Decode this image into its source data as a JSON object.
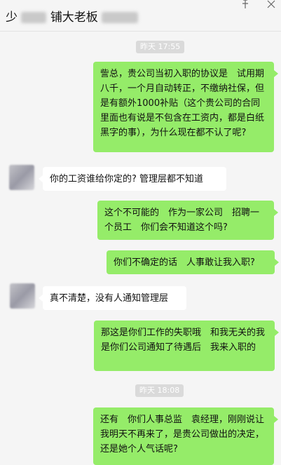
{
  "header": {
    "title_prefix": "少",
    "title_mid": "铺大老板",
    "pin_icon": "pin-icon",
    "close_icon": "close-icon"
  },
  "messages": [
    {
      "type": "time",
      "text": "昨天 17:55"
    },
    {
      "type": "me",
      "text": "訾总，贵公司当初入职的协议是　试用期八千，一个月自动转正，不缴纳社保，但是有额外1000补贴（这个贵公司的合同里面也有说是不包含在工资内，都是白纸黑字的事），为什么现在都不认了呢?"
    },
    {
      "type": "them",
      "text": "你的工资谁给你定的? 管理层都不知道"
    },
    {
      "type": "me",
      "text": "这个不可能的　作为一家公司　招聘一个员工　你们会不知道这个吗?"
    },
    {
      "type": "me",
      "text": "你们不确定的话　人事敢让我入职?"
    },
    {
      "type": "them",
      "text": "真不清楚，没有人通知管理层"
    },
    {
      "type": "me",
      "text": "那这是你们工作的失职哦　和我无关的我是你们公司通知了待遇后　我来入职的"
    },
    {
      "type": "time",
      "text": "昨天 18:08"
    },
    {
      "type": "me",
      "text": "还有　你们人事总监　袁经理，刚刚说让我明天不再来了，是贵公司做出的决定，还是她个人气话呢?"
    }
  ],
  "colors": {
    "me_bubble": "#95ec69",
    "them_bubble": "#ffffff",
    "background": "#f5f5f5"
  }
}
